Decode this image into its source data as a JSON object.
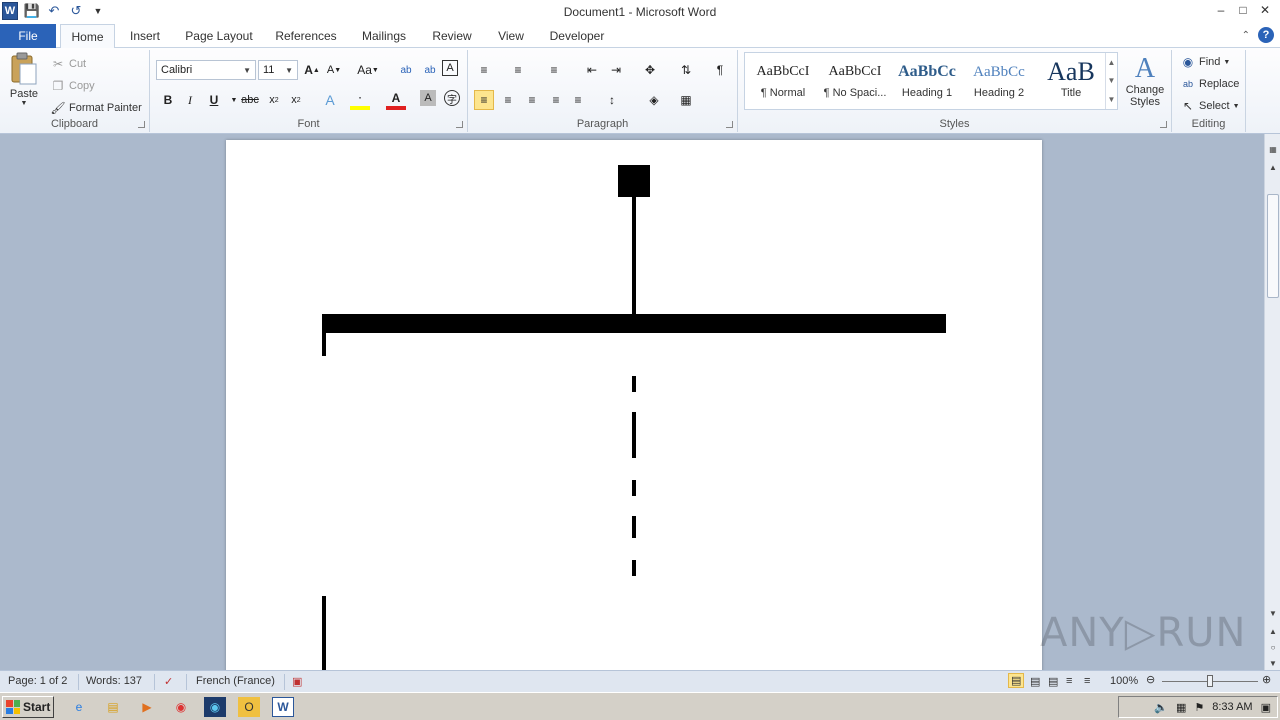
{
  "window": {
    "title": "Document1 - Microsoft Word",
    "logo_letter": "W",
    "controls": [
      "–",
      "□",
      "✕"
    ]
  },
  "tabs": [
    "File",
    "Home",
    "Insert",
    "Page Layout",
    "References",
    "Mailings",
    "Review",
    "View",
    "Developer"
  ],
  "clipboard": {
    "paste": "Paste",
    "cut": "Cut",
    "copy": "Copy",
    "format_painter": "Format Painter",
    "label": "Clipboard"
  },
  "font": {
    "family": "Calibri",
    "size": "11",
    "label": "Font"
  },
  "paragraph": {
    "label": "Paragraph"
  },
  "styles": {
    "label": "Styles",
    "items": [
      {
        "sample": "AaBbCcI",
        "name": "¶ Normal"
      },
      {
        "sample": "AaBbCcI",
        "name": "¶ No Spaci..."
      },
      {
        "sample": "AaBbCc",
        "name": "Heading 1"
      },
      {
        "sample": "AaBbCc",
        "name": "Heading 2"
      },
      {
        "sample": "AaB",
        "name": "Title"
      }
    ],
    "change_styles_line1": "Change",
    "change_styles_line2": "Styles"
  },
  "editing": {
    "find": "Find",
    "replace": "Replace",
    "select": "Select",
    "label": "Editing"
  },
  "status": {
    "page": "Page: 1 of 2",
    "words": "Words: 137",
    "language": "French (France)",
    "zoom": "100%"
  },
  "watermark": "ANY▷RUN",
  "taskbar": {
    "start": "Start",
    "time": "8:33 AM"
  }
}
